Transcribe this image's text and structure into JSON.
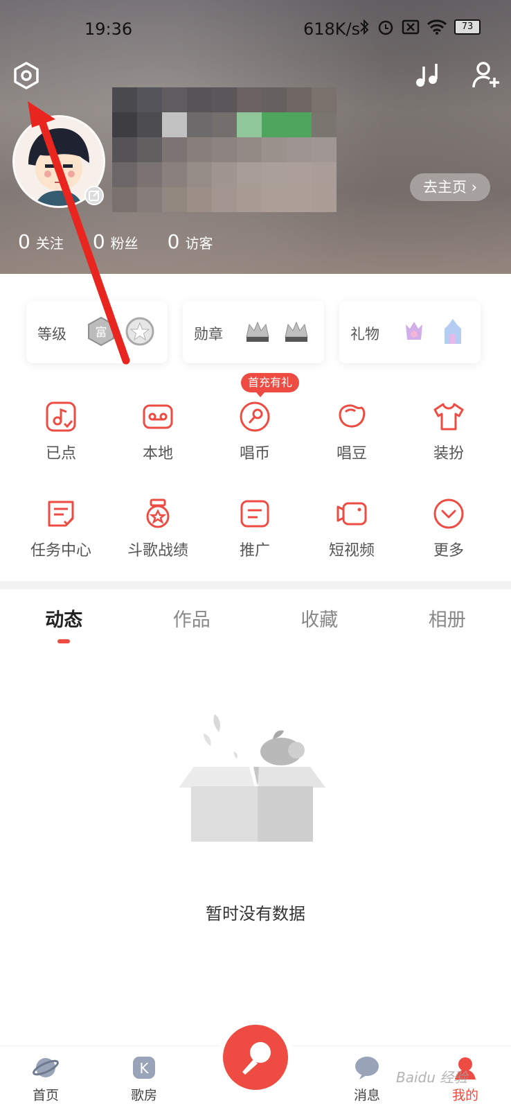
{
  "status_bar": {
    "time": "19:36",
    "network_speed": "618K/s",
    "battery": "73"
  },
  "header": {
    "home_button": "去主页 ›"
  },
  "stats": [
    {
      "num": "0",
      "label": "关注"
    },
    {
      "num": "0",
      "label": "粉丝"
    },
    {
      "num": "0",
      "label": "访客"
    }
  ],
  "cards": [
    {
      "label": "等级"
    },
    {
      "label": "勋章"
    },
    {
      "label": "礼物"
    }
  ],
  "promo_tag": "首充有礼",
  "grid": [
    {
      "label": "已点",
      "icon": "music-note-check-icon"
    },
    {
      "label": "本地",
      "icon": "tape-icon"
    },
    {
      "label": "唱币",
      "icon": "coin-mic-icon"
    },
    {
      "label": "唱豆",
      "icon": "bean-icon"
    },
    {
      "label": "装扮",
      "icon": "tshirt-icon"
    },
    {
      "label": "任务中心",
      "icon": "task-icon"
    },
    {
      "label": "斗歌战绩",
      "icon": "medal-icon"
    },
    {
      "label": "推广",
      "icon": "promote-icon"
    },
    {
      "label": "短视频",
      "icon": "video-icon"
    },
    {
      "label": "更多",
      "icon": "chevron-circle-icon"
    }
  ],
  "tabs": [
    "动态",
    "作品",
    "收藏",
    "相册"
  ],
  "empty_text": "暂时没有数据",
  "tabbar": [
    {
      "label": "首页"
    },
    {
      "label": "歌房"
    },
    {
      "label": "消息"
    },
    {
      "label": "我的"
    }
  ],
  "watermark": "Baidu 经验",
  "colors": {
    "accent": "#ee4b42"
  }
}
